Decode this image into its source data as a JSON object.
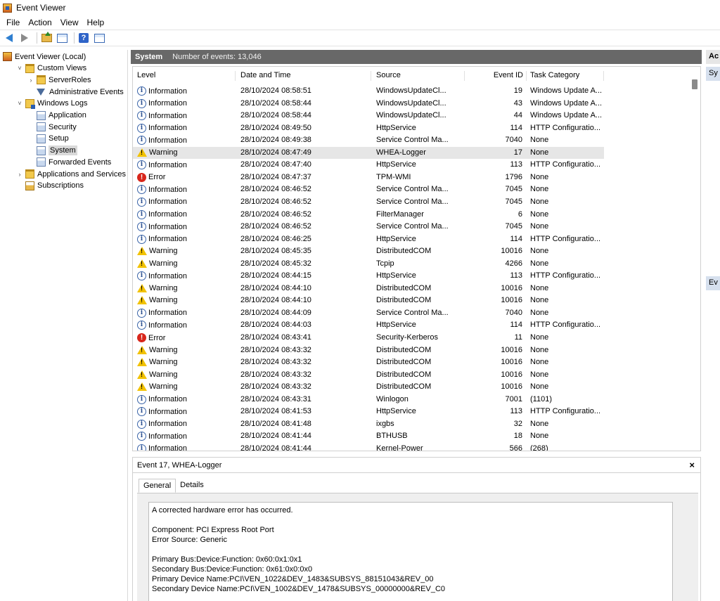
{
  "window": {
    "title": "Event Viewer"
  },
  "menu": [
    "File",
    "Action",
    "View",
    "Help"
  ],
  "tree": [
    {
      "label": "Event Viewer (Local)",
      "icon": "event-viewer-icon",
      "indent": 0,
      "expander": ""
    },
    {
      "label": "Custom Views",
      "icon": "folder-icon",
      "indent": 1,
      "expander": "˅"
    },
    {
      "label": "ServerRoles",
      "icon": "folder-icon",
      "indent": 2,
      "expander": "›"
    },
    {
      "label": "Administrative Events",
      "icon": "filter-icon",
      "indent": 2,
      "expander": ""
    },
    {
      "label": "Windows Logs",
      "icon": "logs-folder-icon",
      "indent": 1,
      "expander": "˅"
    },
    {
      "label": "Application",
      "icon": "log-icon",
      "indent": 2,
      "expander": ""
    },
    {
      "label": "Security",
      "icon": "log-icon",
      "indent": 2,
      "expander": ""
    },
    {
      "label": "Setup",
      "icon": "log-icon",
      "indent": 2,
      "expander": ""
    },
    {
      "label": "System",
      "icon": "log-icon",
      "indent": 2,
      "expander": "",
      "selected": true
    },
    {
      "label": "Forwarded Events",
      "icon": "log-icon",
      "indent": 2,
      "expander": ""
    },
    {
      "label": "Applications and Services Logs",
      "icon": "folder-icon",
      "indent": 1,
      "expander": "›"
    },
    {
      "label": "Subscriptions",
      "icon": "subscriptions-icon",
      "indent": 1,
      "expander": ""
    }
  ],
  "main": {
    "title": "System",
    "count_text": "Number of events: 13,046"
  },
  "columns": [
    "Level",
    "Date and Time",
    "Source",
    "Event ID",
    "Task Category"
  ],
  "events": [
    {
      "level": "Information",
      "date": "28/10/2024 08:58:51",
      "source": "WindowsUpdateCl...",
      "id": "19",
      "category": "Windows Update A..."
    },
    {
      "level": "Information",
      "date": "28/10/2024 08:58:44",
      "source": "WindowsUpdateCl...",
      "id": "43",
      "category": "Windows Update A..."
    },
    {
      "level": "Information",
      "date": "28/10/2024 08:58:44",
      "source": "WindowsUpdateCl...",
      "id": "44",
      "category": "Windows Update A..."
    },
    {
      "level": "Information",
      "date": "28/10/2024 08:49:50",
      "source": "HttpService",
      "id": "114",
      "category": "HTTP Configuratio..."
    },
    {
      "level": "Information",
      "date": "28/10/2024 08:49:38",
      "source": "Service Control Ma...",
      "id": "7040",
      "category": "None"
    },
    {
      "level": "Warning",
      "date": "28/10/2024 08:47:49",
      "source": "WHEA-Logger",
      "id": "17",
      "category": "None",
      "selected": true
    },
    {
      "level": "Information",
      "date": "28/10/2024 08:47:40",
      "source": "HttpService",
      "id": "113",
      "category": "HTTP Configuratio..."
    },
    {
      "level": "Error",
      "date": "28/10/2024 08:47:37",
      "source": "TPM-WMI",
      "id": "1796",
      "category": "None"
    },
    {
      "level": "Information",
      "date": "28/10/2024 08:46:52",
      "source": "Service Control Ma...",
      "id": "7045",
      "category": "None"
    },
    {
      "level": "Information",
      "date": "28/10/2024 08:46:52",
      "source": "Service Control Ma...",
      "id": "7045",
      "category": "None"
    },
    {
      "level": "Information",
      "date": "28/10/2024 08:46:52",
      "source": "FilterManager",
      "id": "6",
      "category": "None"
    },
    {
      "level": "Information",
      "date": "28/10/2024 08:46:52",
      "source": "Service Control Ma...",
      "id": "7045",
      "category": "None"
    },
    {
      "level": "Information",
      "date": "28/10/2024 08:46:25",
      "source": "HttpService",
      "id": "114",
      "category": "HTTP Configuratio..."
    },
    {
      "level": "Warning",
      "date": "28/10/2024 08:45:35",
      "source": "DistributedCOM",
      "id": "10016",
      "category": "None"
    },
    {
      "level": "Warning",
      "date": "28/10/2024 08:45:32",
      "source": "Tcpip",
      "id": "4266",
      "category": "None"
    },
    {
      "level": "Information",
      "date": "28/10/2024 08:44:15",
      "source": "HttpService",
      "id": "113",
      "category": "HTTP Configuratio..."
    },
    {
      "level": "Warning",
      "date": "28/10/2024 08:44:10",
      "source": "DistributedCOM",
      "id": "10016",
      "category": "None"
    },
    {
      "level": "Warning",
      "date": "28/10/2024 08:44:10",
      "source": "DistributedCOM",
      "id": "10016",
      "category": "None"
    },
    {
      "level": "Information",
      "date": "28/10/2024 08:44:09",
      "source": "Service Control Ma...",
      "id": "7040",
      "category": "None"
    },
    {
      "level": "Information",
      "date": "28/10/2024 08:44:03",
      "source": "HttpService",
      "id": "114",
      "category": "HTTP Configuratio..."
    },
    {
      "level": "Error",
      "date": "28/10/2024 08:43:41",
      "source": "Security-Kerberos",
      "id": "11",
      "category": "None"
    },
    {
      "level": "Warning",
      "date": "28/10/2024 08:43:32",
      "source": "DistributedCOM",
      "id": "10016",
      "category": "None"
    },
    {
      "level": "Warning",
      "date": "28/10/2024 08:43:32",
      "source": "DistributedCOM",
      "id": "10016",
      "category": "None"
    },
    {
      "level": "Warning",
      "date": "28/10/2024 08:43:32",
      "source": "DistributedCOM",
      "id": "10016",
      "category": "None"
    },
    {
      "level": "Warning",
      "date": "28/10/2024 08:43:32",
      "source": "DistributedCOM",
      "id": "10016",
      "category": "None"
    },
    {
      "level": "Information",
      "date": "28/10/2024 08:43:31",
      "source": "Winlogon",
      "id": "7001",
      "category": "(1101)"
    },
    {
      "level": "Information",
      "date": "28/10/2024 08:41:53",
      "source": "HttpService",
      "id": "113",
      "category": "HTTP Configuratio..."
    },
    {
      "level": "Information",
      "date": "28/10/2024 08:41:48",
      "source": "ixgbs",
      "id": "32",
      "category": "None"
    },
    {
      "level": "Information",
      "date": "28/10/2024 08:41:44",
      "source": "BTHUSB",
      "id": "18",
      "category": "None"
    },
    {
      "level": "Information",
      "date": "28/10/2024 08:41:44",
      "source": "Kernel-Power",
      "id": "566",
      "category": "(268)"
    }
  ],
  "detail": {
    "title": "Event 17, WHEA-Logger",
    "close": "×",
    "tabs": [
      "General",
      "Details"
    ],
    "lines": [
      "A corrected hardware error has occurred.",
      "",
      "Component: PCI Express Root Port",
      "Error Source: Generic",
      "",
      "Primary Bus:Device:Function: 0x60:0x1:0x1",
      "Secondary Bus:Device:Function: 0x61:0x0:0x0",
      "Primary Device Name:PCI\\VEN_1022&DEV_1483&SUBSYS_88151043&REV_00",
      "Secondary Device Name:PCI\\VEN_1002&DEV_1478&SUBSYS_00000000&REV_C0"
    ]
  },
  "actions": {
    "header": "Ac",
    "sections": [
      "Sy",
      "Ev"
    ]
  },
  "colors": {
    "header_bg": "#686868",
    "selection": "#e6e6e6",
    "error": "#d8261b",
    "warning": "#f2c200"
  }
}
